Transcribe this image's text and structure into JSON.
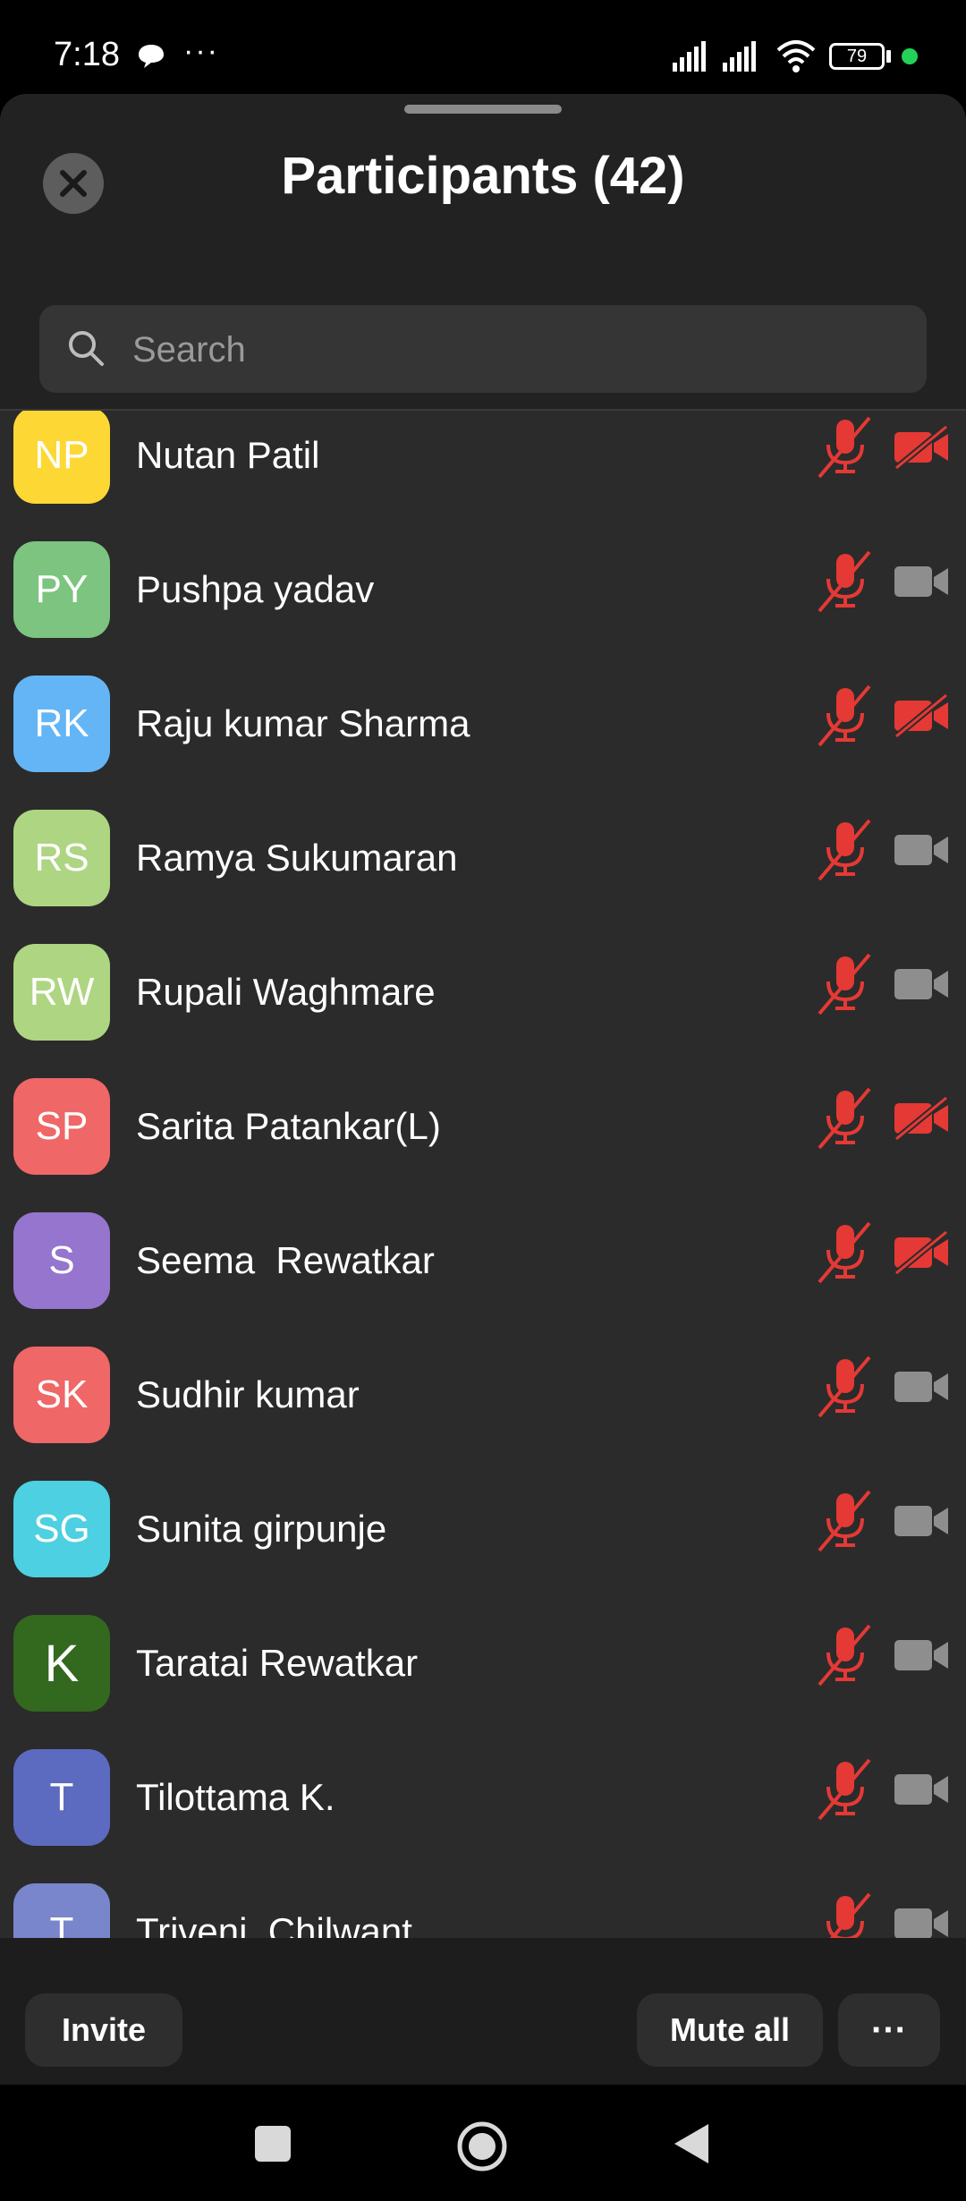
{
  "status_bar": {
    "time": "7:18",
    "more": "···",
    "battery": "79"
  },
  "header": {
    "title": "Participants (42)"
  },
  "search": {
    "placeholder": "Search"
  },
  "participants": [
    {
      "initials": "NP",
      "name": "Nutan Patil",
      "avatar_color": "#fdd835",
      "mic_muted": true,
      "video_off": true
    },
    {
      "initials": "PY",
      "name": "Pushpa yadav",
      "avatar_color": "#7cc47f",
      "mic_muted": true,
      "video_off": false
    },
    {
      "initials": "RK",
      "name": "Raju kumar Sharma",
      "avatar_color": "#64b5f6",
      "mic_muted": true,
      "video_off": true
    },
    {
      "initials": "RS",
      "name": "Ramya Sukumaran",
      "avatar_color": "#aed581",
      "mic_muted": true,
      "video_off": false
    },
    {
      "initials": "RW",
      "name": "Rupali Waghmare",
      "avatar_color": "#aed581",
      "mic_muted": true,
      "video_off": false
    },
    {
      "initials": "SP",
      "name": "Sarita Patankar(L)",
      "avatar_color": "#ef6767",
      "mic_muted": true,
      "video_off": true
    },
    {
      "initials": "S",
      "name": "Seema  Rewatkar",
      "avatar_color": "#9575cd",
      "mic_muted": true,
      "video_off": true
    },
    {
      "initials": "SK",
      "name": "Sudhir kumar",
      "avatar_color": "#ef6767",
      "mic_muted": true,
      "video_off": false
    },
    {
      "initials": "SG",
      "name": "Sunita girpunje",
      "avatar_color": "#4dd0e1",
      "mic_muted": true,
      "video_off": false
    },
    {
      "initials": "K",
      "name": "Taratai Rewatkar",
      "avatar_color": "#33691e",
      "mic_muted": true,
      "video_off": false
    },
    {
      "initials": "T",
      "name": "Tilottama K.",
      "avatar_color": "#5c6bc0",
      "mic_muted": true,
      "video_off": false
    },
    {
      "initials": "T",
      "name": "Triveni  Chilwant",
      "avatar_color": "#7986cb",
      "mic_muted": true,
      "video_off": false
    }
  ],
  "footer": {
    "invite": "Invite",
    "mute_all": "Mute all",
    "more": "···"
  },
  "colors": {
    "muted_red": "#e53935",
    "camera_gray": "#8e8e8e"
  }
}
